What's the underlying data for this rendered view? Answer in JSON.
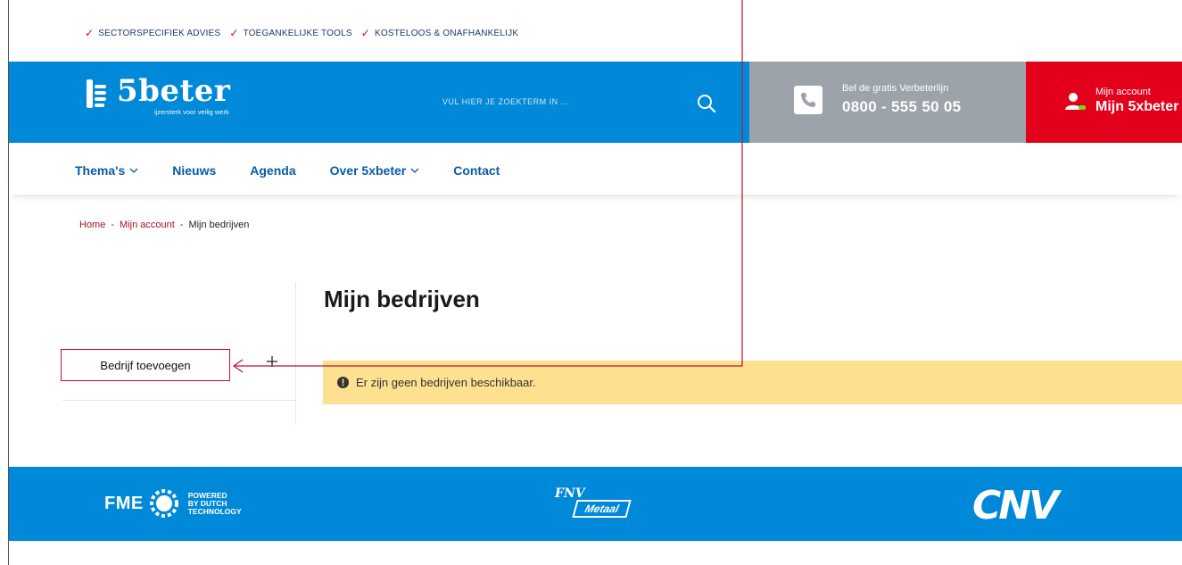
{
  "usp": [
    "SECTORSPECIFIEK ADVIES",
    "TOEGANKELIJKE TOOLS",
    "KOSTELOOS & ONAFHANKELIJK"
  ],
  "header": {
    "logo_word": "5beter",
    "logo_tagline": "ijzersterk voor veilig werk",
    "search_placeholder": "VUL HIER JE ZOEKTERM IN ...",
    "phone_label": "Bel de gratis Verbeterlijn",
    "phone_number": "0800 - 555 50 05",
    "account_label": "Mijn account",
    "account_name": "Mijn 5xbeter"
  },
  "nav": [
    {
      "label": "Thema's",
      "dropdown": true
    },
    {
      "label": "Nieuws",
      "dropdown": false
    },
    {
      "label": "Agenda",
      "dropdown": false
    },
    {
      "label": "Over 5xbeter",
      "dropdown": true
    },
    {
      "label": "Contact",
      "dropdown": false
    }
  ],
  "breadcrumb": {
    "home": "Home",
    "sep": "-",
    "account": "Mijn account",
    "current": "Mijn bedrijven"
  },
  "sidebar": {
    "add_company": "Bedrijf toevoegen"
  },
  "main": {
    "title": "Mijn bedrijven",
    "alert": "Er zijn geen bedrijven beschikbaar."
  },
  "footer": {
    "fme_word": "FME",
    "fme_sub1": "POWERED",
    "fme_sub2": "BY DUTCH",
    "fme_sub3": "TECHNOLOGY",
    "fnv_top": "FNV",
    "fnv_bottom": "Metaal",
    "cnv": "CNV"
  },
  "colors": {
    "brand_blue": "#0089d8",
    "phone_grey": "#9ca3aa",
    "account_red": "#e3001b",
    "alert_yellow": "#fde090",
    "annotation_red": "#c8102e"
  }
}
